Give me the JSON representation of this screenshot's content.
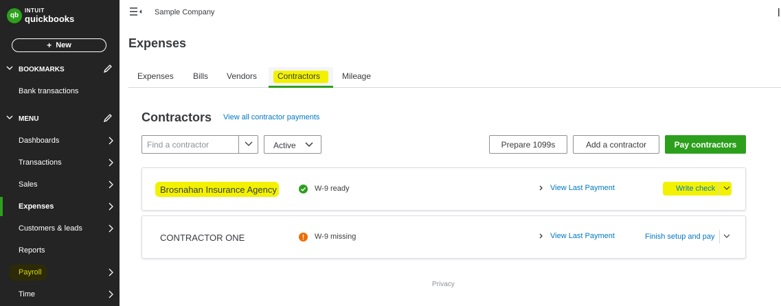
{
  "brand": {
    "intuit": "INTUIT",
    "product": "quickbooks",
    "badge": "qb",
    "accent": "#2ca01c"
  },
  "sidebar": {
    "new_label": "New",
    "bookmarks": {
      "label": "BOOKMARKS",
      "items": [
        {
          "label": "Bank transactions"
        }
      ]
    },
    "menu": {
      "label": "MENU",
      "items": [
        {
          "label": "Dashboards"
        },
        {
          "label": "Transactions"
        },
        {
          "label": "Sales"
        },
        {
          "label": "Expenses",
          "active": true
        },
        {
          "label": "Customers & leads"
        },
        {
          "label": "Reports"
        },
        {
          "label": "Payroll",
          "highlighted": true
        },
        {
          "label": "Time"
        }
      ]
    }
  },
  "topbar": {
    "company": "Sample Company"
  },
  "page": {
    "title": "Expenses"
  },
  "tabs": [
    {
      "label": "Expenses"
    },
    {
      "label": "Bills"
    },
    {
      "label": "Vendors"
    },
    {
      "label": "Contractors",
      "active": true
    },
    {
      "label": "Mileage"
    }
  ],
  "contractors": {
    "title": "Contractors",
    "view_all_link": "View all contractor payments",
    "search": {
      "placeholder": "Find a contractor",
      "value": ""
    },
    "filter": {
      "selected": "Active"
    },
    "buttons": {
      "prepare_1099s": "Prepare 1099s",
      "add_contractor": "Add a contractor",
      "pay_contractors": "Pay contractors"
    },
    "rows": [
      {
        "name": "Brosnahan Insurance Agency",
        "status": "W-9 ready",
        "status_color": "#2ca01c",
        "view_last": "View Last Payment",
        "action": "Write check"
      },
      {
        "name": "CONTRACTOR ONE",
        "status": "W-9 missing",
        "status_color": "#ef6c00",
        "view_last": "View Last Payment",
        "action": "Finish setup and pay"
      }
    ]
  },
  "footer": {
    "privacy": "Privacy"
  },
  "colors": {
    "sidebar_bg": "#242424",
    "link": "#0077c5",
    "highlight": "#f2f200"
  }
}
